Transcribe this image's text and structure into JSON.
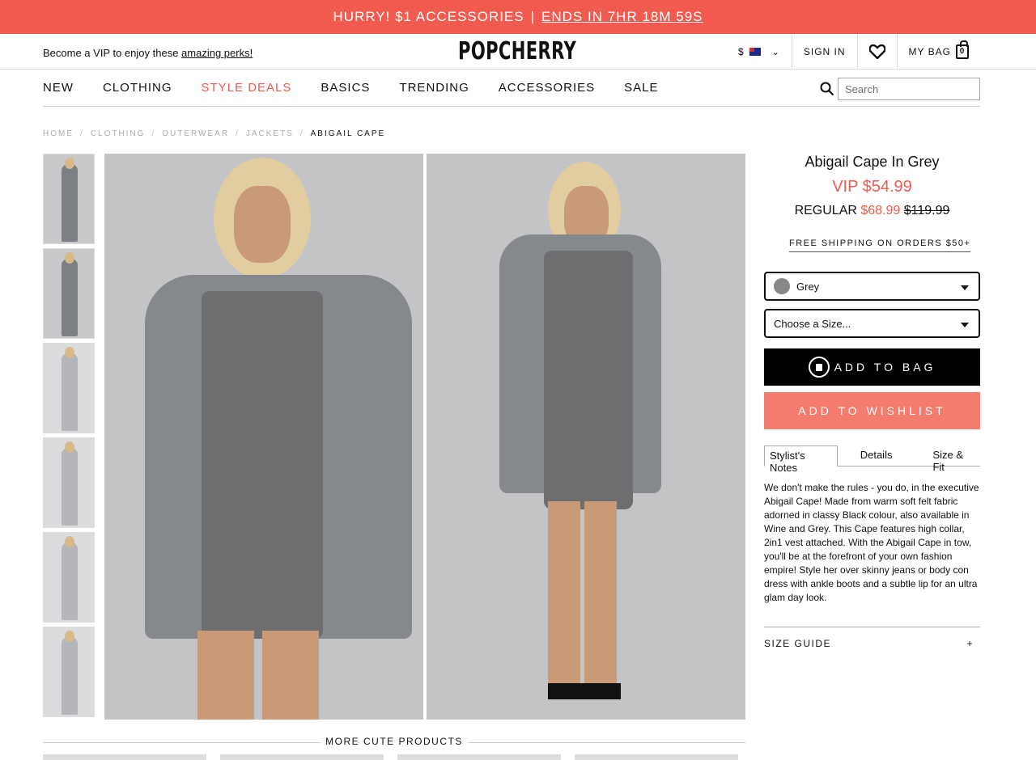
{
  "promo": {
    "text": "HURRY! $1 ACCESSORIES",
    "sep": "|",
    "link": "ENDS IN 7HR 18M 59S"
  },
  "topbar": {
    "vip_prefix": "Become a VIP to enjoy these",
    "vip_link": "amazing perks!",
    "logo": "POPCHERRY",
    "currency": "$",
    "sign_in": "SIGN IN",
    "my_bag": "MY BAG",
    "bag_count": "0"
  },
  "nav": {
    "items": [
      "NEW",
      "CLOTHING",
      "STYLE DEALS",
      "BASICS",
      "TRENDING",
      "ACCESSORIES",
      "SALE"
    ],
    "search_placeholder": "Search"
  },
  "breadcrumb": [
    "HOME",
    "CLOTHING",
    "OUTERWEAR",
    "JACKETS",
    "ABIGAIL CAPE"
  ],
  "product": {
    "title": "Abigail Cape In Grey",
    "vip_price": "VIP $54.99",
    "regular_label": "REGULAR",
    "regular_sale": "$68.99",
    "regular_orig": "$119.99",
    "shipping": "FREE SHIPPING ON ORDERS $50+",
    "color_selected": "Grey",
    "size_placeholder": "Choose a Size...",
    "add_to_bag": "ADD TO BAG",
    "add_to_wishlist": "ADD TO WISHLIST",
    "tabs": [
      "Stylist's Notes",
      "Details",
      "Size & Fit"
    ],
    "notes": "We don't make the rules - you do, in the executive Abigail Cape! Made from warm soft felt fabric adorned in classy Black colour, also available in Wine and Grey. This Cape features high collar, 2in1 vest attached. With the Abigail Cape in tow, you'll be at the forefront of your own fashion empire! Style her over skinny jeans or body con dress with ankle boots and a subtle lip for an ultra glam day look.",
    "size_guide": "SIZE GUIDE",
    "size_guide_toggle": "+"
  },
  "more": {
    "label": "MORE CUTE PRODUCTS"
  },
  "colors": {
    "accent": "#f15a4e",
    "wishlist": "#f47c6f"
  }
}
